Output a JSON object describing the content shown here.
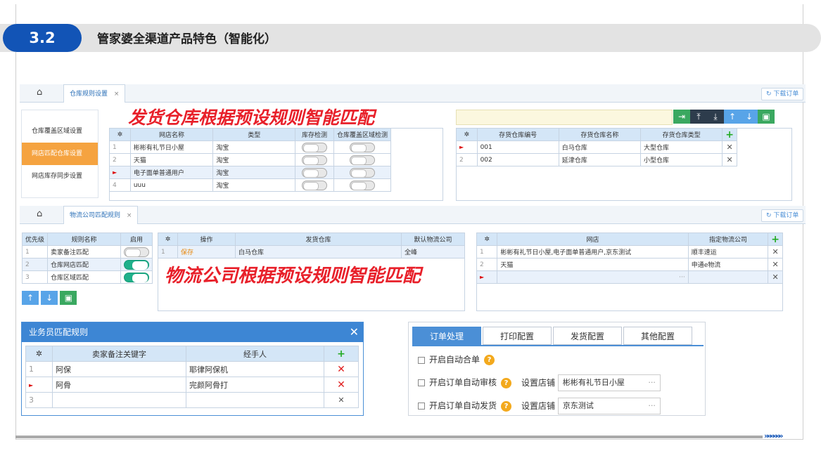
{
  "header": {
    "badge": "3.2",
    "title": "管家婆全渠道产品特色（智能化）"
  },
  "colors": {
    "brand": "#1254b6",
    "accent": "#f5a340",
    "annotation": "#e8202a",
    "toggle_on": "#1fb08a"
  },
  "panel1": {
    "tab": "仓库规则设置",
    "download": "下载订单",
    "sidebar": [
      "仓库覆盖区域设置",
      "网店匹配仓库设置",
      "网店库存同步设置"
    ],
    "annotation": "发货仓库根据预设规则智能匹配",
    "store_table": {
      "headers": [
        "网店名称",
        "类型",
        "库存检测",
        "仓库覆盖区域检测"
      ],
      "rows": [
        {
          "n": "1",
          "name": "彬彬有礼节日小屋",
          "type": "淘宝"
        },
        {
          "n": "2",
          "name": "天猫",
          "type": "淘宝"
        },
        {
          "n": "",
          "name": "电子面单普通用户",
          "type": "淘宝"
        },
        {
          "n": "4",
          "name": "uuu",
          "type": "淘宝"
        }
      ]
    },
    "wh_table": {
      "headers": [
        "存货仓库编号",
        "存货仓库名称",
        "存货仓库类型"
      ],
      "rows": [
        {
          "n": "",
          "code": "001",
          "name": "白马仓库",
          "type": "大型仓库"
        },
        {
          "n": "2",
          "code": "002",
          "name": "延津仓库",
          "type": "小型仓库"
        }
      ]
    }
  },
  "panel2": {
    "tab": "物流公司匹配规则",
    "download": "下载订单",
    "annotation": "物流公司根据预设规则智能匹配",
    "rule_table": {
      "headers": [
        "优先级",
        "规则名称",
        "启用"
      ],
      "rows": [
        {
          "n": "1",
          "name": "卖家备注匹配",
          "on": false
        },
        {
          "n": "2",
          "name": "仓库网店匹配",
          "on": true
        },
        {
          "n": "3",
          "name": "仓库区域匹配",
          "on": true
        }
      ]
    },
    "op_table": {
      "headers": [
        "操作",
        "发货仓库",
        "默认物流公司"
      ],
      "rows": [
        {
          "n": "1",
          "op": "保存",
          "wh": "白马仓库",
          "co": "全峰"
        }
      ]
    },
    "ship_table": {
      "headers": [
        "网店",
        "指定物流公司"
      ],
      "rows": [
        {
          "n": "1",
          "store": "彬彬有礼节日小屋,电子面单普通用户,京东测试",
          "co": "顺丰速运"
        },
        {
          "n": "2",
          "store": "天猫",
          "co": "申通e物流"
        },
        {
          "n": "",
          "store": "",
          "co": ""
        }
      ]
    }
  },
  "salesman": {
    "title": "业务员匹配规则",
    "headers": [
      "卖家备注关键字",
      "经手人"
    ],
    "rows": [
      {
        "n": "1",
        "kw": "阿保",
        "handler": "耶律阿保机"
      },
      {
        "n": "",
        "kw": "阿骨",
        "handler": "完颜阿骨打"
      },
      {
        "n": "3",
        "kw": "",
        "handler": ""
      }
    ]
  },
  "config": {
    "tabs": [
      "订单处理",
      "打印配置",
      "发货配置",
      "其他配置"
    ],
    "opt1": "开启自动合单",
    "opt2": "开启订单自动审核",
    "opt3": "开启订单自动发货",
    "store_label": "设置店铺",
    "store1": "彬彬有礼节日小屋",
    "store2": "京东测试"
  }
}
